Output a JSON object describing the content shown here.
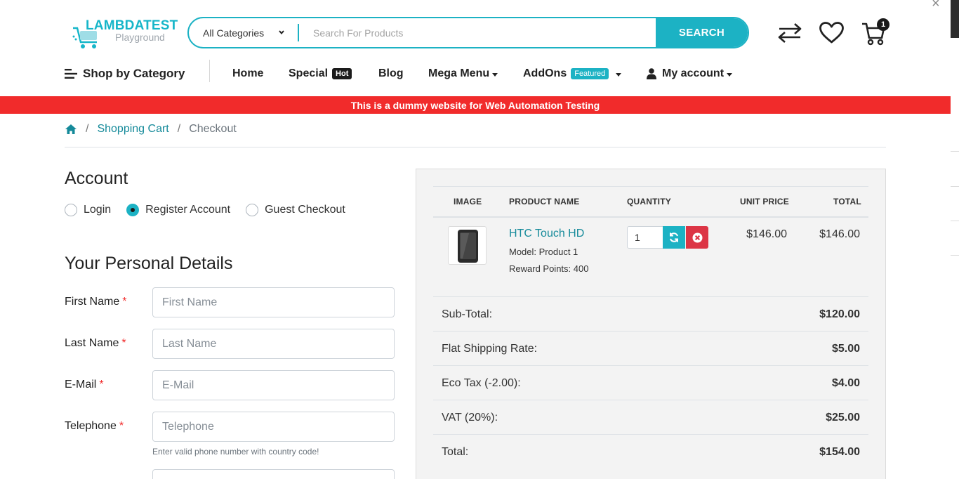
{
  "header": {
    "logo_brand": "LAMBDATEST",
    "logo_sub": "Playground",
    "search_category": "All Categories",
    "search_placeholder": "Search For Products",
    "search_button": "SEARCH",
    "cart_count": "1",
    "close_glyph": "×",
    "accent_color": "#1cb2c4"
  },
  "nav": {
    "shop_by_category": "Shop by Category",
    "home": "Home",
    "special": "Special",
    "special_badge": "Hot",
    "blog": "Blog",
    "mega_menu": "Mega Menu",
    "addons": "AddOns",
    "addons_badge": "Featured",
    "my_account": "My account"
  },
  "banner": {
    "text": "This is a dummy website for Web Automation Testing",
    "color": "#f12b2b"
  },
  "breadcrumb": {
    "sep1": "/",
    "shopping_cart": "Shopping Cart",
    "sep2": "/",
    "current": "Checkout"
  },
  "account": {
    "title": "Account",
    "options": [
      {
        "label": "Login",
        "selected": false
      },
      {
        "label": "Register Account",
        "selected": true
      },
      {
        "label": "Guest Checkout",
        "selected": false
      }
    ]
  },
  "personal": {
    "title": "Your Personal Details",
    "required_mark": "*",
    "fields": [
      {
        "label": "First Name",
        "placeholder": "First Name"
      },
      {
        "label": "Last Name",
        "placeholder": "Last Name"
      },
      {
        "label": "E-Mail",
        "placeholder": "E-Mail"
      },
      {
        "label": "Telephone",
        "placeholder": "Telephone"
      }
    ],
    "telephone_help": "Enter valid phone number with country code!"
  },
  "cart": {
    "headers": {
      "image": "IMAGE",
      "product_name": "PRODUCT NAME",
      "quantity": "QUANTITY",
      "unit_price": "UNIT PRICE",
      "total": "TOTAL"
    },
    "item": {
      "name": "HTC Touch HD",
      "model": "Model: Product 1",
      "reward": "Reward Points: 400",
      "quantity": "1",
      "unit_price": "$146.00",
      "total": "$146.00"
    },
    "totals": [
      {
        "label": "Sub-Total:",
        "value": "$120.00"
      },
      {
        "label": "Flat Shipping Rate:",
        "value": "$5.00"
      },
      {
        "label": "Eco Tax (-2.00):",
        "value": "$4.00"
      },
      {
        "label": "VAT (20%):",
        "value": "$25.00"
      },
      {
        "label": "Total:",
        "value": "$154.00"
      }
    ]
  }
}
